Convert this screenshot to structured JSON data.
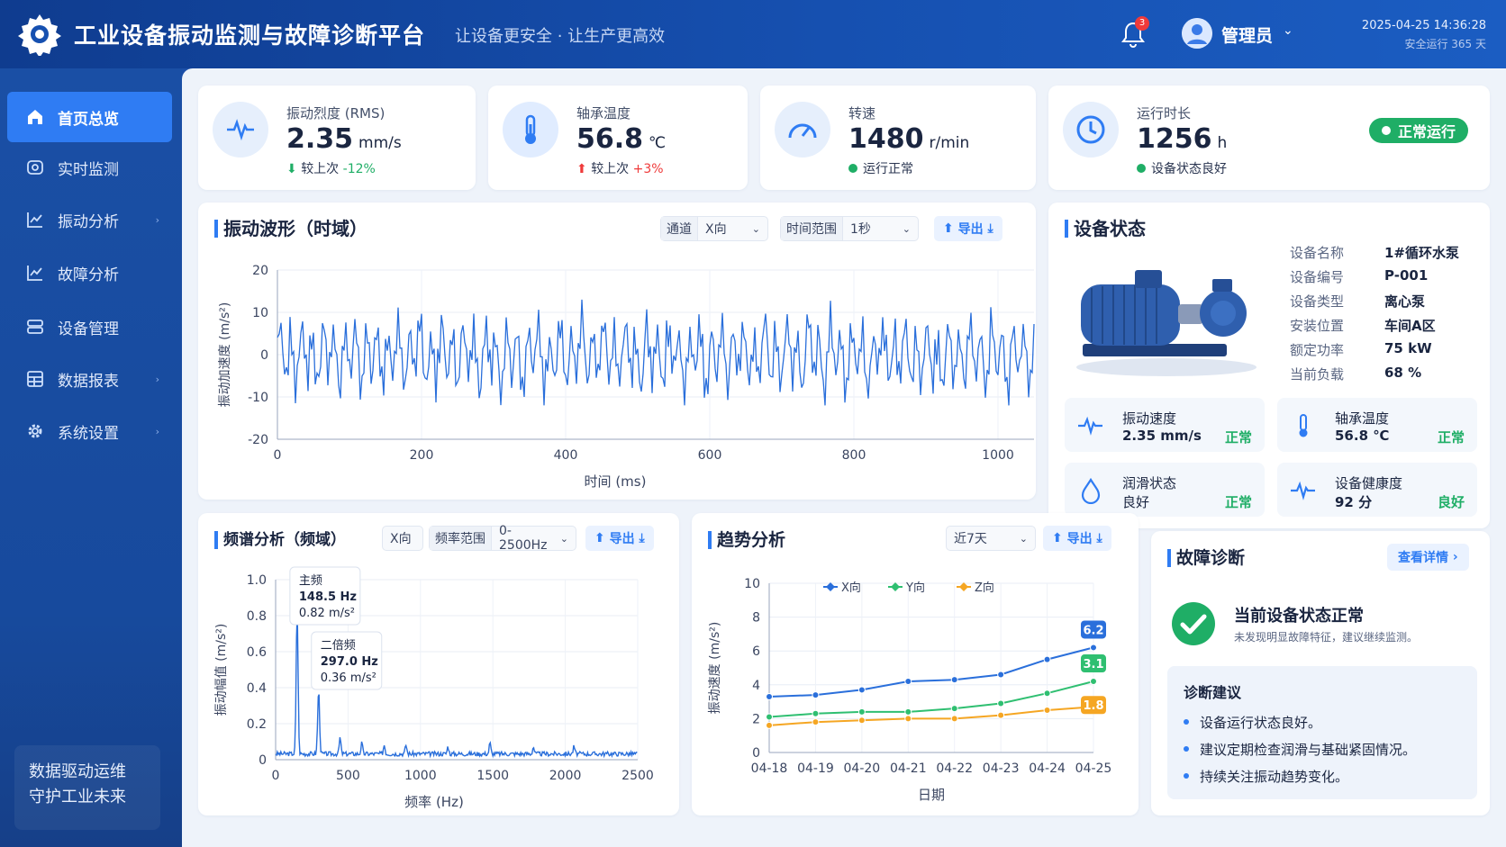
{
  "header": {
    "title": "工业设备振动监测与故障诊断平台",
    "slogan": "让设备更安全 · 让生产更高效",
    "notification_count": "3",
    "user_name": "管理员",
    "datetime": "2025-04-25 14:36:28",
    "uptime": "安全运行 365 天"
  },
  "sidebar": {
    "items": [
      {
        "label": "首页总览",
        "icon": "home-icon",
        "active": true
      },
      {
        "label": "实时监测",
        "icon": "monitor-icon"
      },
      {
        "label": "振动分析",
        "icon": "line-chart-icon"
      },
      {
        "label": "故障分析",
        "icon": "line-chart-icon"
      },
      {
        "label": "设备管理",
        "icon": "equipment-icon"
      },
      {
        "label": "数据报表",
        "icon": "table-icon"
      },
      {
        "label": "系统设置",
        "icon": "gear-icon"
      }
    ],
    "footer_line1": "数据驱动运维",
    "footer_line2": "守护工业未来"
  },
  "stats": [
    {
      "label": "振动烈度 (RMS)",
      "value": "2.35",
      "unit": "mm/s",
      "trend_prefix": "较上次",
      "trend": "-12%",
      "trend_dir": "down",
      "icon": "pulse-icon"
    },
    {
      "label": "轴承温度",
      "value": "56.8",
      "unit": "℃",
      "trend_prefix": "较上次",
      "trend": "+3%",
      "trend_dir": "up",
      "icon": "thermometer-icon"
    },
    {
      "label": "转速",
      "value": "1480",
      "unit": "r/min",
      "status": "运行正常",
      "icon": "speedometer-icon"
    },
    {
      "label": "运行时长",
      "value": "1256",
      "unit": "h",
      "status": "设备状态良好",
      "badge": "正常运行",
      "icon": "clock-icon"
    }
  ],
  "waveform": {
    "title": "振动波形（时域）",
    "channel_label": "通道",
    "channel_value": "X向",
    "range_label": "时间范围",
    "range_value": "1秒",
    "export_label": "导出",
    "color": "#2a6fdb",
    "chart_data": {
      "type": "line",
      "title": "振动波形（时域）",
      "xlabel": "时间 (ms)",
      "ylabel": "振动加速度 (m/s²)",
      "xlim": [
        0,
        1050
      ],
      "ylim": [
        -20,
        20
      ],
      "xticks": [
        0,
        200,
        400,
        600,
        800,
        1000
      ],
      "yticks": [
        -20,
        -10,
        0,
        10,
        20
      ],
      "grid": true,
      "signal_min": -12,
      "signal_max": 13
    }
  },
  "device": {
    "title": "设备状态",
    "rows": [
      {
        "key": "设备名称",
        "value": "1#循环水泵"
      },
      {
        "key": "设备编号",
        "value": "P-001"
      },
      {
        "key": "设备类型",
        "value": "离心泵"
      },
      {
        "key": "安装位置",
        "value": "车间A区"
      },
      {
        "key": "额定功率",
        "value": "75 kW"
      },
      {
        "key": "当前负载",
        "value": "68 %"
      }
    ],
    "minis": [
      {
        "label": "振动速度",
        "value": "2.35 mm/s",
        "status": "正常",
        "icon": "pulse-icon"
      },
      {
        "label": "轴承温度",
        "value": "56.8 ℃",
        "status": "正常",
        "icon": "thermometer-icon"
      },
      {
        "label": "润滑状态",
        "value": "良好",
        "status": "正常",
        "icon": "drop-icon"
      },
      {
        "label": "设备健康度",
        "value": "92 分",
        "status": "良好",
        "icon": "pulse-icon"
      }
    ]
  },
  "spectrum": {
    "title": "频谱分析（频域）",
    "channel_value": "X向",
    "range_label": "频率范围",
    "range_value": "0-2500Hz",
    "export_label": "导出",
    "color": "#2a6fdb",
    "chart_data": {
      "type": "line",
      "title": "频谱分析（频域）",
      "xlabel": "频率 (Hz)",
      "ylabel": "振动幅值 (m/s²)",
      "xlim": [
        0,
        2500
      ],
      "ylim": [
        0,
        1.0
      ],
      "xticks": [
        0,
        500,
        1000,
        1500,
        2000,
        2500
      ],
      "xtick_labels": [
        "0",
        "500",
        "1000",
        "1500",
        "2000",
        "2500"
      ],
      "yticks": [
        0,
        0.2,
        0.4,
        0.6,
        0.8,
        1.0
      ],
      "grid": true,
      "peaks": [
        {
          "x": 148.5,
          "y": 0.82
        },
        {
          "x": 297.0,
          "y": 0.36
        }
      ],
      "annotations": [
        {
          "title": "主频",
          "freq": "148.5 Hz",
          "amp": "0.82 m/s²"
        },
        {
          "title": "二倍频",
          "freq": "297.0 Hz",
          "amp": "0.36 m/s²"
        }
      ]
    }
  },
  "trend": {
    "title": "趋势分析",
    "range_value": "近7天",
    "export_label": "导出",
    "chart_data": {
      "type": "line",
      "title": "趋势分析",
      "xlabel": "日期",
      "ylabel": "振动速度 (m/s²)",
      "categories": [
        "04-18",
        "04-19",
        "04-20",
        "04-21",
        "04-22",
        "04-23",
        "04-24",
        "04-25"
      ],
      "ylim": [
        0,
        10
      ],
      "yticks": [
        0,
        2,
        4,
        6,
        8,
        10
      ],
      "grid": true,
      "legend": "top",
      "series": [
        {
          "name": "X向",
          "color": "#2a6fdb",
          "values": [
            3.3,
            3.4,
            3.7,
            4.2,
            4.3,
            4.6,
            5.5,
            6.2
          ]
        },
        {
          "name": "Y向",
          "color": "#2fbf71",
          "values": [
            2.1,
            2.3,
            2.4,
            2.4,
            2.6,
            2.9,
            3.5,
            4.2
          ]
        },
        {
          "name": "Z向",
          "color": "#f5a623",
          "values": [
            1.6,
            1.8,
            1.9,
            2.0,
            2.0,
            2.2,
            2.5,
            2.7
          ]
        }
      ],
      "end_labels": [
        "6.2",
        "3.1",
        "1.8"
      ]
    }
  },
  "diagnosis": {
    "title": "故障诊断",
    "detail_label": "查看详情",
    "status_title": "当前设备状态正常",
    "status_sub": "未发现明显故障特征，建议继续监测。",
    "suggest_title": "诊断建议",
    "suggestions": [
      "设备运行状态良好。",
      "建议定期检查润滑与基础紧固情况。",
      "持续关注振动趋势变化。"
    ],
    "ok_color": "#1fae66"
  }
}
